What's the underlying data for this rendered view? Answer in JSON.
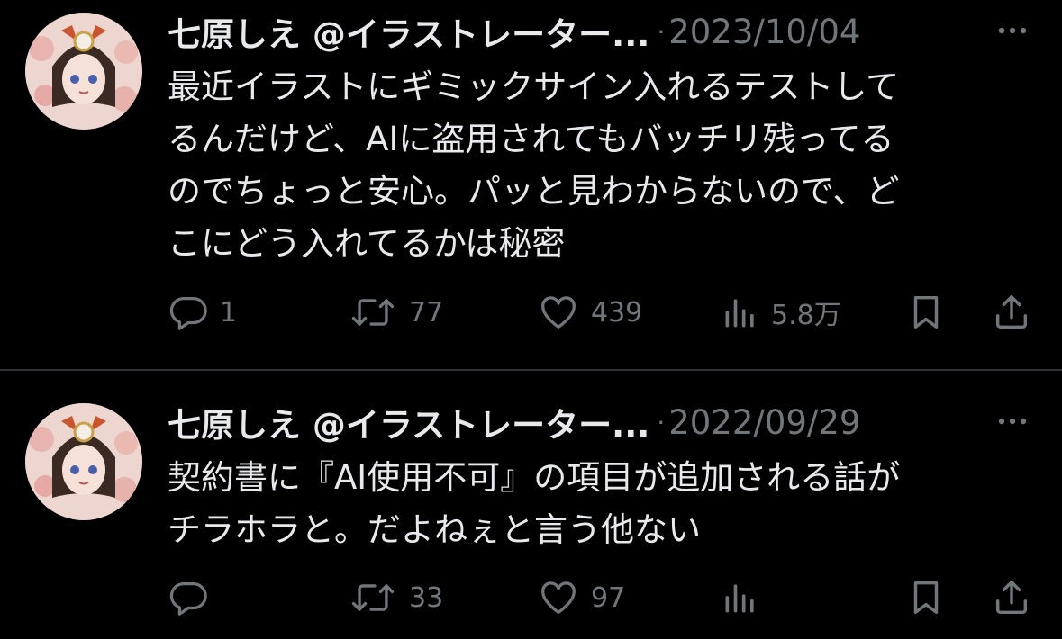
{
  "tweets": [
    {
      "author": "七原しえ @イラストレーター...",
      "separator": "·",
      "date": "2023/10/04",
      "text_lines": [
        "最近イラストにギミックサイン入れるテストして",
        "るんだけど、AIに盗用されてもバッチリ残ってる",
        "のでちょっと安心。パッと見わからないので、ど",
        "こにどう入れてるかは秘密"
      ],
      "replies": "1",
      "reposts": "77",
      "likes": "439",
      "views": "5.8万"
    },
    {
      "author": "七原しえ @イラストレーター...",
      "separator": "·",
      "date": "2022/09/29",
      "text_lines": [
        "契約書に『AI使用不可』の項目が追加される話が",
        "チラホラと。だよねぇと言う他ない"
      ],
      "replies": "",
      "reposts": "33",
      "likes": "97",
      "views": ""
    }
  ],
  "icons": [
    "avatar",
    "more-icon",
    "reply-icon",
    "repost-icon",
    "like-icon",
    "views-icon",
    "bookmark-icon",
    "share-icon"
  ],
  "colors": {
    "background": "#000000",
    "text": "#e7e9ea",
    "secondary": "#71767b",
    "divider": "#2f3336"
  }
}
